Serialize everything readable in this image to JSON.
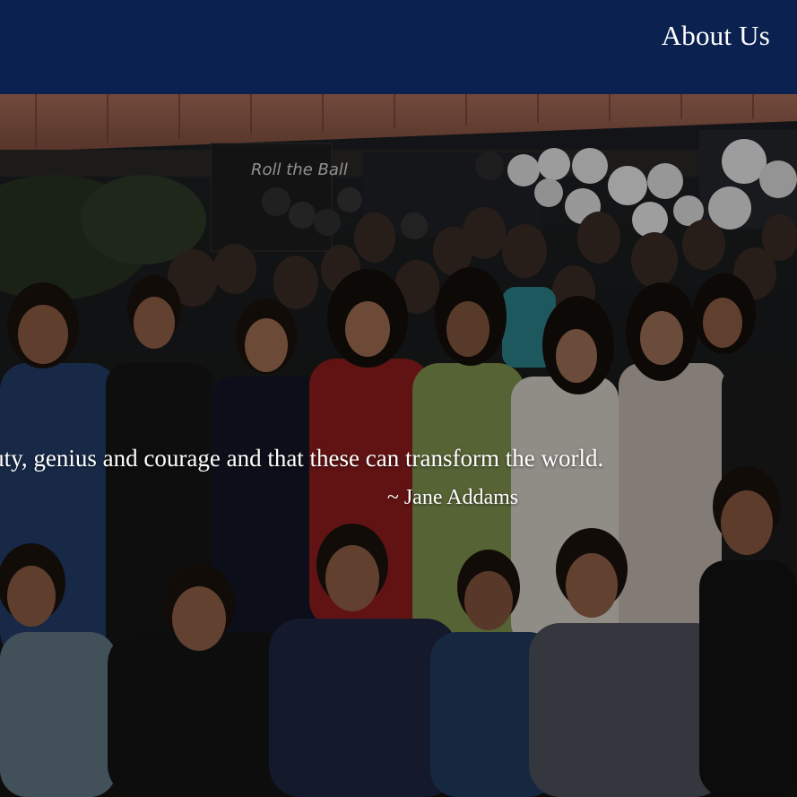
{
  "header": {
    "title": "About Us"
  },
  "hero": {
    "image_description_icon": "group-photo",
    "quote": "Founded in a belief in beauty, genius and courage and that these can transform the world.",
    "author": "~ Jane Addams",
    "sign_text": "Roll the Ball"
  },
  "colors": {
    "header_bg": "#0b2250",
    "text": "#ffffff"
  }
}
